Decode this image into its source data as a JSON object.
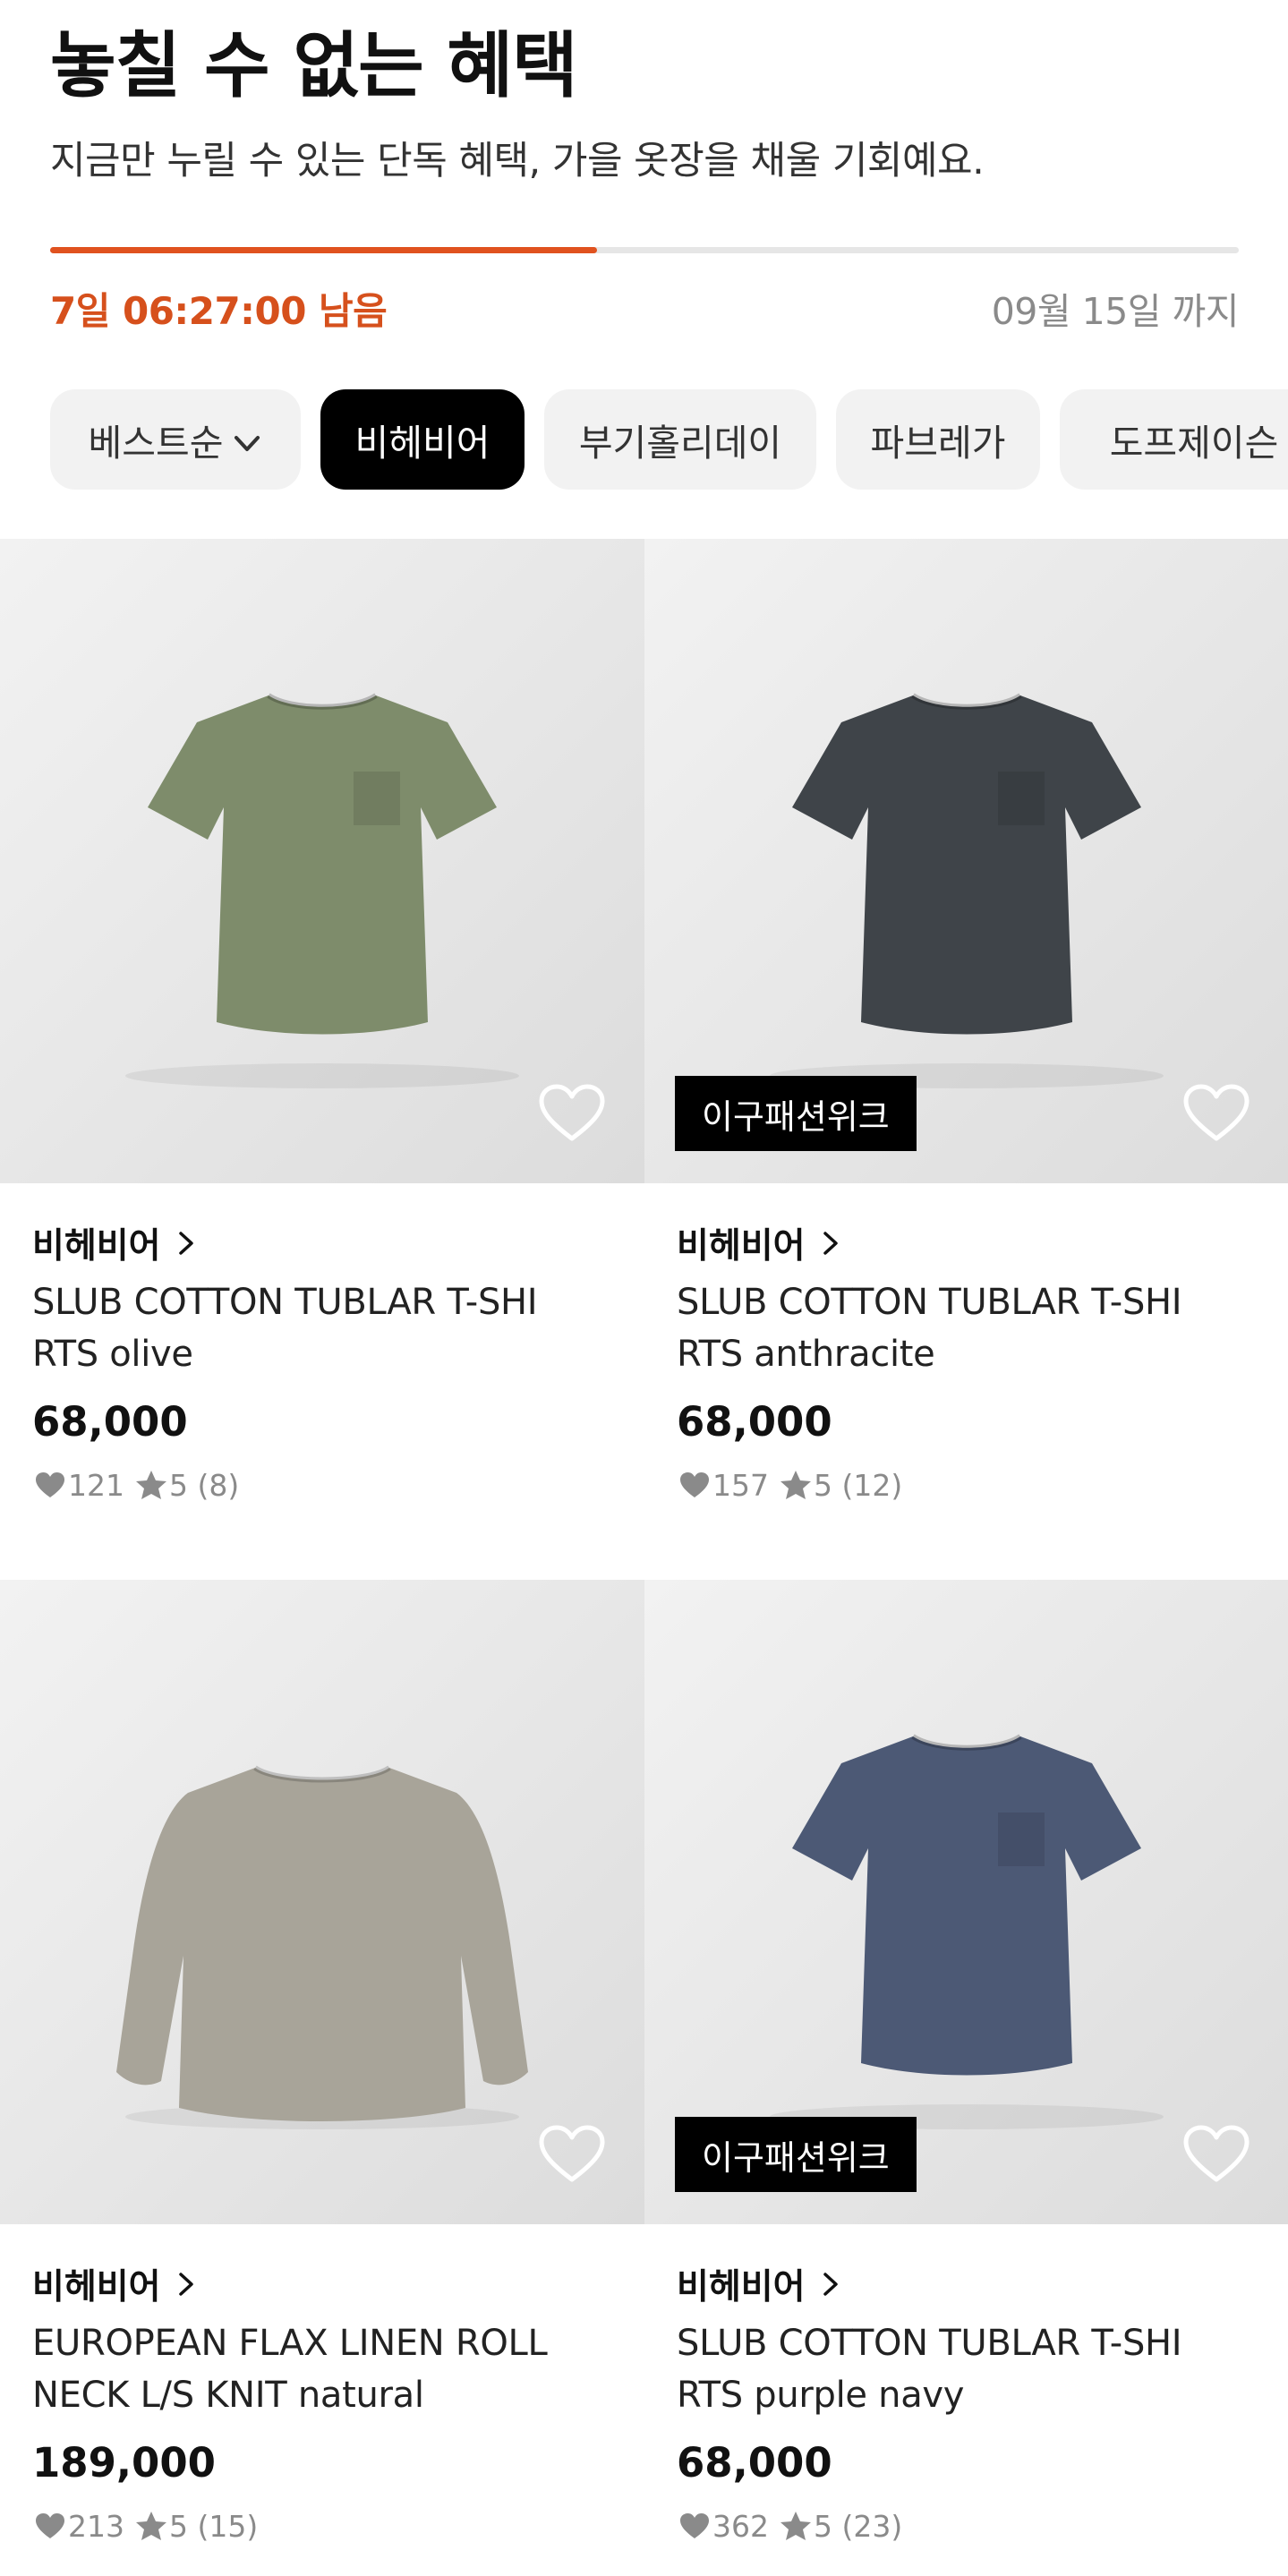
{
  "header": {
    "title": "놓칠 수 없는 혜택",
    "subtitle": "지금만 누릴 수 있는 단독 혜택, 가을 옷장을 채울 기회예요.",
    "progress_fraction": 0.46,
    "timer": "7일 06:27:00 남음",
    "deadline": "09월 15일 까지"
  },
  "filters": {
    "sort_label": "베스트순",
    "chips": [
      "비헤비어",
      "부기홀리데이",
      "파브레가",
      "도프제이슨"
    ],
    "active_chip": "비헤비어"
  },
  "products": [
    {
      "brand": "비헤비어",
      "name_line1": "SLUB COTTON TUBLAR T-SHI",
      "name_line2": "RTS olive",
      "price": "68,000",
      "likes": "121",
      "rating": "5 (8)",
      "badge": "",
      "shirt_color": "#7e8c6b",
      "style": "tee"
    },
    {
      "brand": "비헤비어",
      "name_line1": "SLUB COTTON TUBLAR T-SHI",
      "name_line2": "RTS anthracite",
      "price": "68,000",
      "likes": "157",
      "rating": "5 (12)",
      "badge": "이구패션위크",
      "shirt_color": "#3f4449",
      "style": "tee"
    },
    {
      "brand": "비헤비어",
      "name_line1": "EUROPEAN FLAX LINEN ROLL",
      "name_line2": "NECK L/S KNIT natural",
      "price": "189,000",
      "likes": "213",
      "rating": "5 (15)",
      "badge": "",
      "shirt_color": "#a8a499",
      "style": "longsleeve"
    },
    {
      "brand": "비헤비어",
      "name_line1": "SLUB COTTON TUBLAR T-SHI",
      "name_line2": "RTS purple navy",
      "price": "68,000",
      "likes": "362",
      "rating": "5 (23)",
      "badge": "이구패션위크",
      "shirt_color": "#4c5975",
      "style": "tee"
    }
  ]
}
